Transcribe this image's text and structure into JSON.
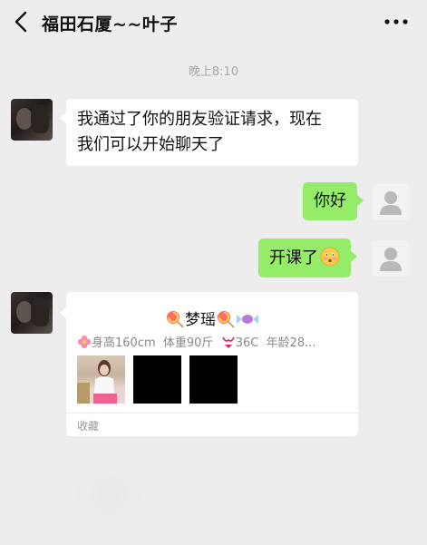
{
  "header": {
    "title": "福田石厦~~叶子",
    "back_icon": "chevron-left-icon",
    "more_icon": "ellipsis-icon"
  },
  "timestamp": "晚上8:10",
  "messages": [
    {
      "from": "friend",
      "text_line1": "我通过了你的朋友验证请求，现在",
      "text_line2": "我们可以开始聊天了"
    },
    {
      "from": "self",
      "text": "你好"
    },
    {
      "from": "self",
      "text": "开课了",
      "emoji": "flushed-face-emoji"
    }
  ],
  "card": {
    "name": "梦瑶",
    "name_icons": [
      "lollipop-icon",
      "lollipop-icon",
      "candy-icon"
    ],
    "stats": {
      "height": "身高160cm",
      "weight": "体重90斤",
      "bust": "36C",
      "age": "年龄28..."
    },
    "stat_icons": [
      "flower-icon",
      "bikini-icon"
    ],
    "footer": "收藏"
  },
  "colors": {
    "background": "#ededed",
    "self_bubble": "#95ec69",
    "friend_bubble": "#ffffff"
  }
}
